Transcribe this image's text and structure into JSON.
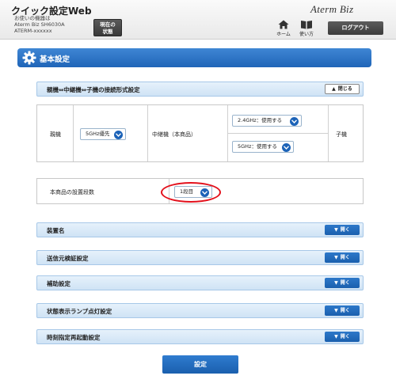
{
  "header": {
    "app_title": "クイック設定Web",
    "model_label": "お使いの機器は",
    "model_name": "Aterm Biz SH6030A",
    "model_id": "ATERM-xxxxxx",
    "status_button": "現在の\n状態",
    "brand": "Aterm Biz",
    "home_label": "ホーム",
    "usage_label": "使い方",
    "logout_label": "ログアウト"
  },
  "page": {
    "title": "基本設定"
  },
  "connection_section": {
    "title": "親機⇔中継機⇔子機の接続形式設定",
    "toggle_label": "閉じる",
    "parent_label": "親機",
    "parent_select": "5GHz優先",
    "repeater_label": "中継機（本商品）",
    "select_24": "2.4GHz：使用する",
    "select_5": "5GHz：使用する",
    "child_label": "子機"
  },
  "install_section": {
    "label": "本商品の設置段数",
    "select": "1段目"
  },
  "sections": [
    {
      "title": "装置名",
      "toggle": "開く"
    },
    {
      "title": "送信元検証設定",
      "toggle": "開く"
    },
    {
      "title": "補助設定",
      "toggle": "開く"
    },
    {
      "title": "状態表示ランプ点灯設定",
      "toggle": "開く"
    },
    {
      "title": "時刻指定再起動設定",
      "toggle": "開く"
    }
  ],
  "submit_label": "設定",
  "colors": {
    "accent": "#1f65b8",
    "section_bg": "#d8e8f7",
    "highlight": "#e3101b"
  },
  "icons": {
    "title": "gear-icon",
    "home": "home-icon",
    "usage": "book-icon",
    "toggle_open": "chevron-down-icon",
    "toggle_close": "chevron-up-icon"
  }
}
